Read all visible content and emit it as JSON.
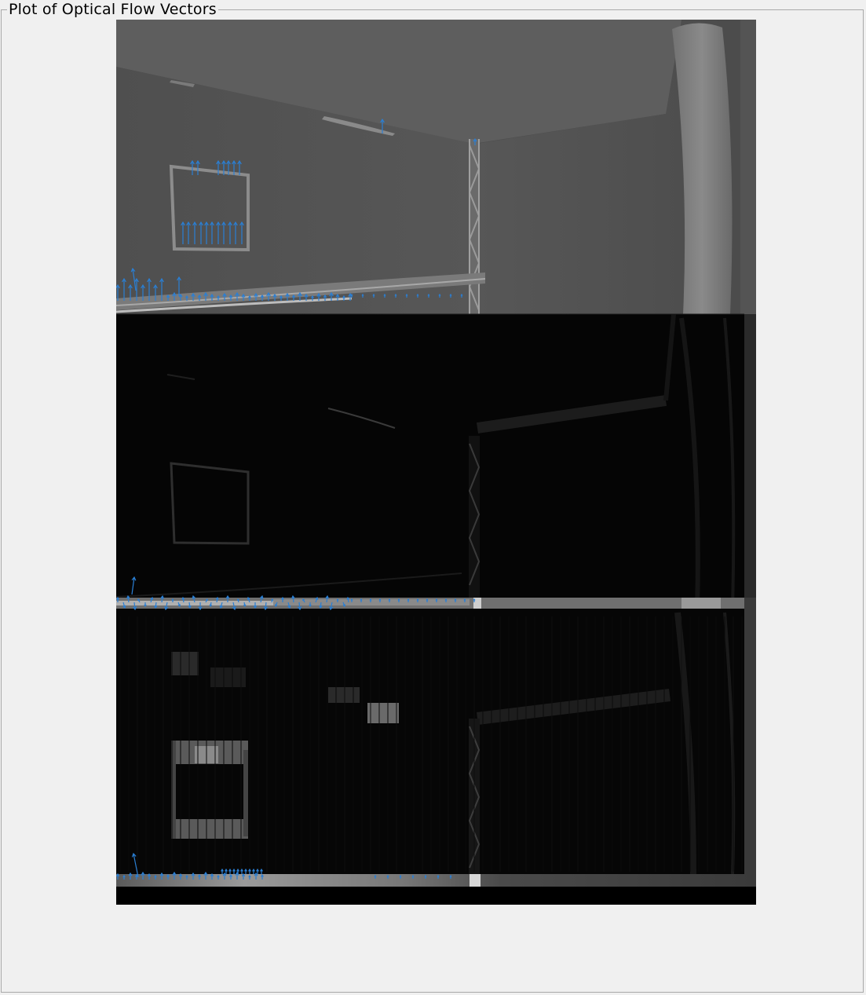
{
  "panel": {
    "title": "Plot of Optical Flow Vectors"
  },
  "plot": {
    "image_description_icon": "grayscale-frame-image",
    "vector_color": "#2a7fd4"
  },
  "colors": {
    "background": "#f0f0f0",
    "panel_border": "#a9a9a9",
    "axes_background": "#000000",
    "frame1_wall": "#555555",
    "frame1_ceiling": "#5d5d5d"
  }
}
